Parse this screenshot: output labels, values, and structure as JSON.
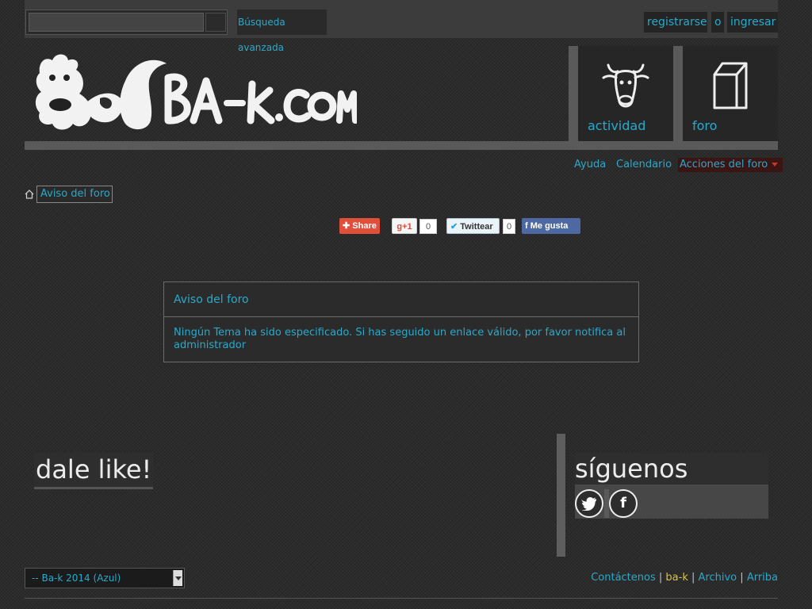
{
  "topbar": {
    "search_placeholder": "",
    "advanced_search": "Búsqueda avanzada",
    "register": "registrarse",
    "or": "o",
    "login": "ingresar"
  },
  "header": {
    "logo_text": "BA-K.COM",
    "nav": [
      {
        "label": "actividad",
        "icon": "cow-head-icon"
      },
      {
        "label": "foro",
        "icon": "milk-carton-icon"
      }
    ]
  },
  "subnav": {
    "help": "Ayuda",
    "calendar": "Calendario",
    "forum_actions": "Acciones del foro"
  },
  "breadcrumb": {
    "current": "Aviso del foro"
  },
  "share": {
    "addthis": "Share",
    "gplus": "+1",
    "gplus_count": "0",
    "tweet": "Twittear",
    "tweet_count": "0",
    "fb_like": "Me gusta"
  },
  "notice": {
    "title": "Aviso del foro",
    "message": "Ningún Tema ha sido especificado. Si has seguido un enlace válido, por favor notifica al",
    "link": "administrador"
  },
  "widgets": {
    "like_title": "dale like!",
    "follow_title": "síguenos",
    "social": [
      "twitter-icon",
      "facebook-icon"
    ]
  },
  "footer": {
    "style_selected": "-- Ba-k 2014 (Azul)",
    "links": [
      "Contáctenos",
      "ba-k",
      "Archivo",
      "Arriba"
    ],
    "separator": "|"
  },
  "colors": {
    "link": "#2aa9ca",
    "background": "#2c2c2c",
    "highlight": "#d8c34a"
  }
}
